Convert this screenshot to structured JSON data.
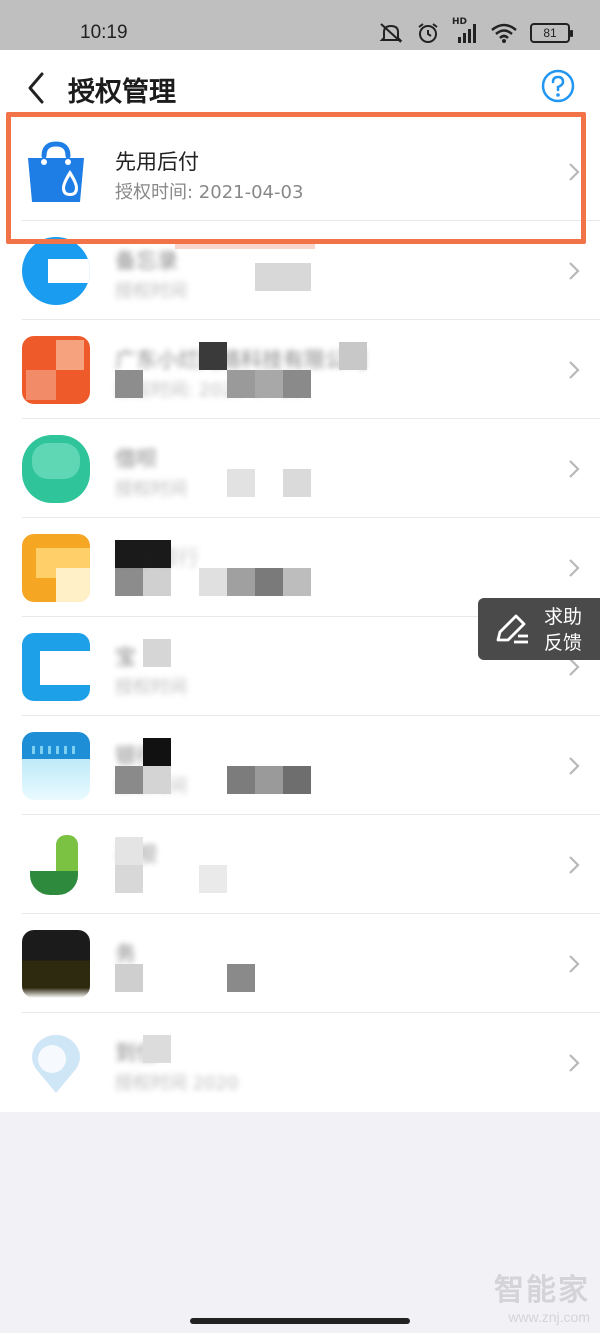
{
  "status_bar": {
    "time": "10:19",
    "network_label": "HD",
    "battery": "81",
    "icons": [
      "mute-bell-icon",
      "alarm-icon",
      "signal-icon",
      "wifi-icon",
      "battery-icon"
    ]
  },
  "header": {
    "title": "授权管理",
    "back_icon": "chevron-left-icon",
    "help_icon": "question-circle-icon"
  },
  "list": {
    "items": [
      {
        "name": "先用后付",
        "time_prefix": "授权时间:",
        "date": "2021-04-03",
        "time_label": "授权时间: 2021-04-03",
        "icon": "shopping-bag-icon",
        "color": "#1f7de6",
        "obscured": false,
        "highlighted": true
      },
      {
        "name": "备忘录",
        "time_label": "授权时间",
        "icon": "app-icon-blue",
        "color": "#1a9cf0",
        "obscured": true
      },
      {
        "name": "广东小烂网络科技有限公司",
        "time_label": "授权时间: 2020-07-19",
        "icon": "app-icon-orange",
        "color": "#ef5a2a",
        "obscured": true
      },
      {
        "name": "借呗",
        "time_label": "授权时间",
        "icon": "app-icon-green",
        "color": "#2fc49a",
        "obscured": true
      },
      {
        "name": "商家银行",
        "time_label": "",
        "icon": "app-icon-yellow",
        "color": "#f5a623",
        "obscured": true
      },
      {
        "name": "宝",
        "time_label": "授权时间",
        "icon": "app-icon-cyan",
        "color": "#1ea0e8",
        "obscured": true
      },
      {
        "name": "银行",
        "time_label": "授权时间",
        "icon": "app-icon-teal",
        "color": "#1e8ed6",
        "obscured": true
      },
      {
        "name": "花呗",
        "time_label": "",
        "icon": "app-icon-lime",
        "color": "#4caf50",
        "obscured": true
      },
      {
        "name": "务",
        "time_label": "",
        "icon": "app-icon-dark",
        "color": "#2e2a10",
        "obscured": true
      },
      {
        "name": "到位",
        "time_label": "授权时间 2020",
        "icon": "app-icon-location",
        "color": "#7ab8e8",
        "obscured": true
      }
    ]
  },
  "feedback": {
    "label": "求助反馈",
    "icon": "pencil-edit-icon"
  },
  "watermark": {
    "main": "智能家",
    "sub": "www.znj.com"
  },
  "colors": {
    "highlight_border": "#f27348",
    "accent_blue": "#1f7de6",
    "help_blue": "#2196f3"
  }
}
